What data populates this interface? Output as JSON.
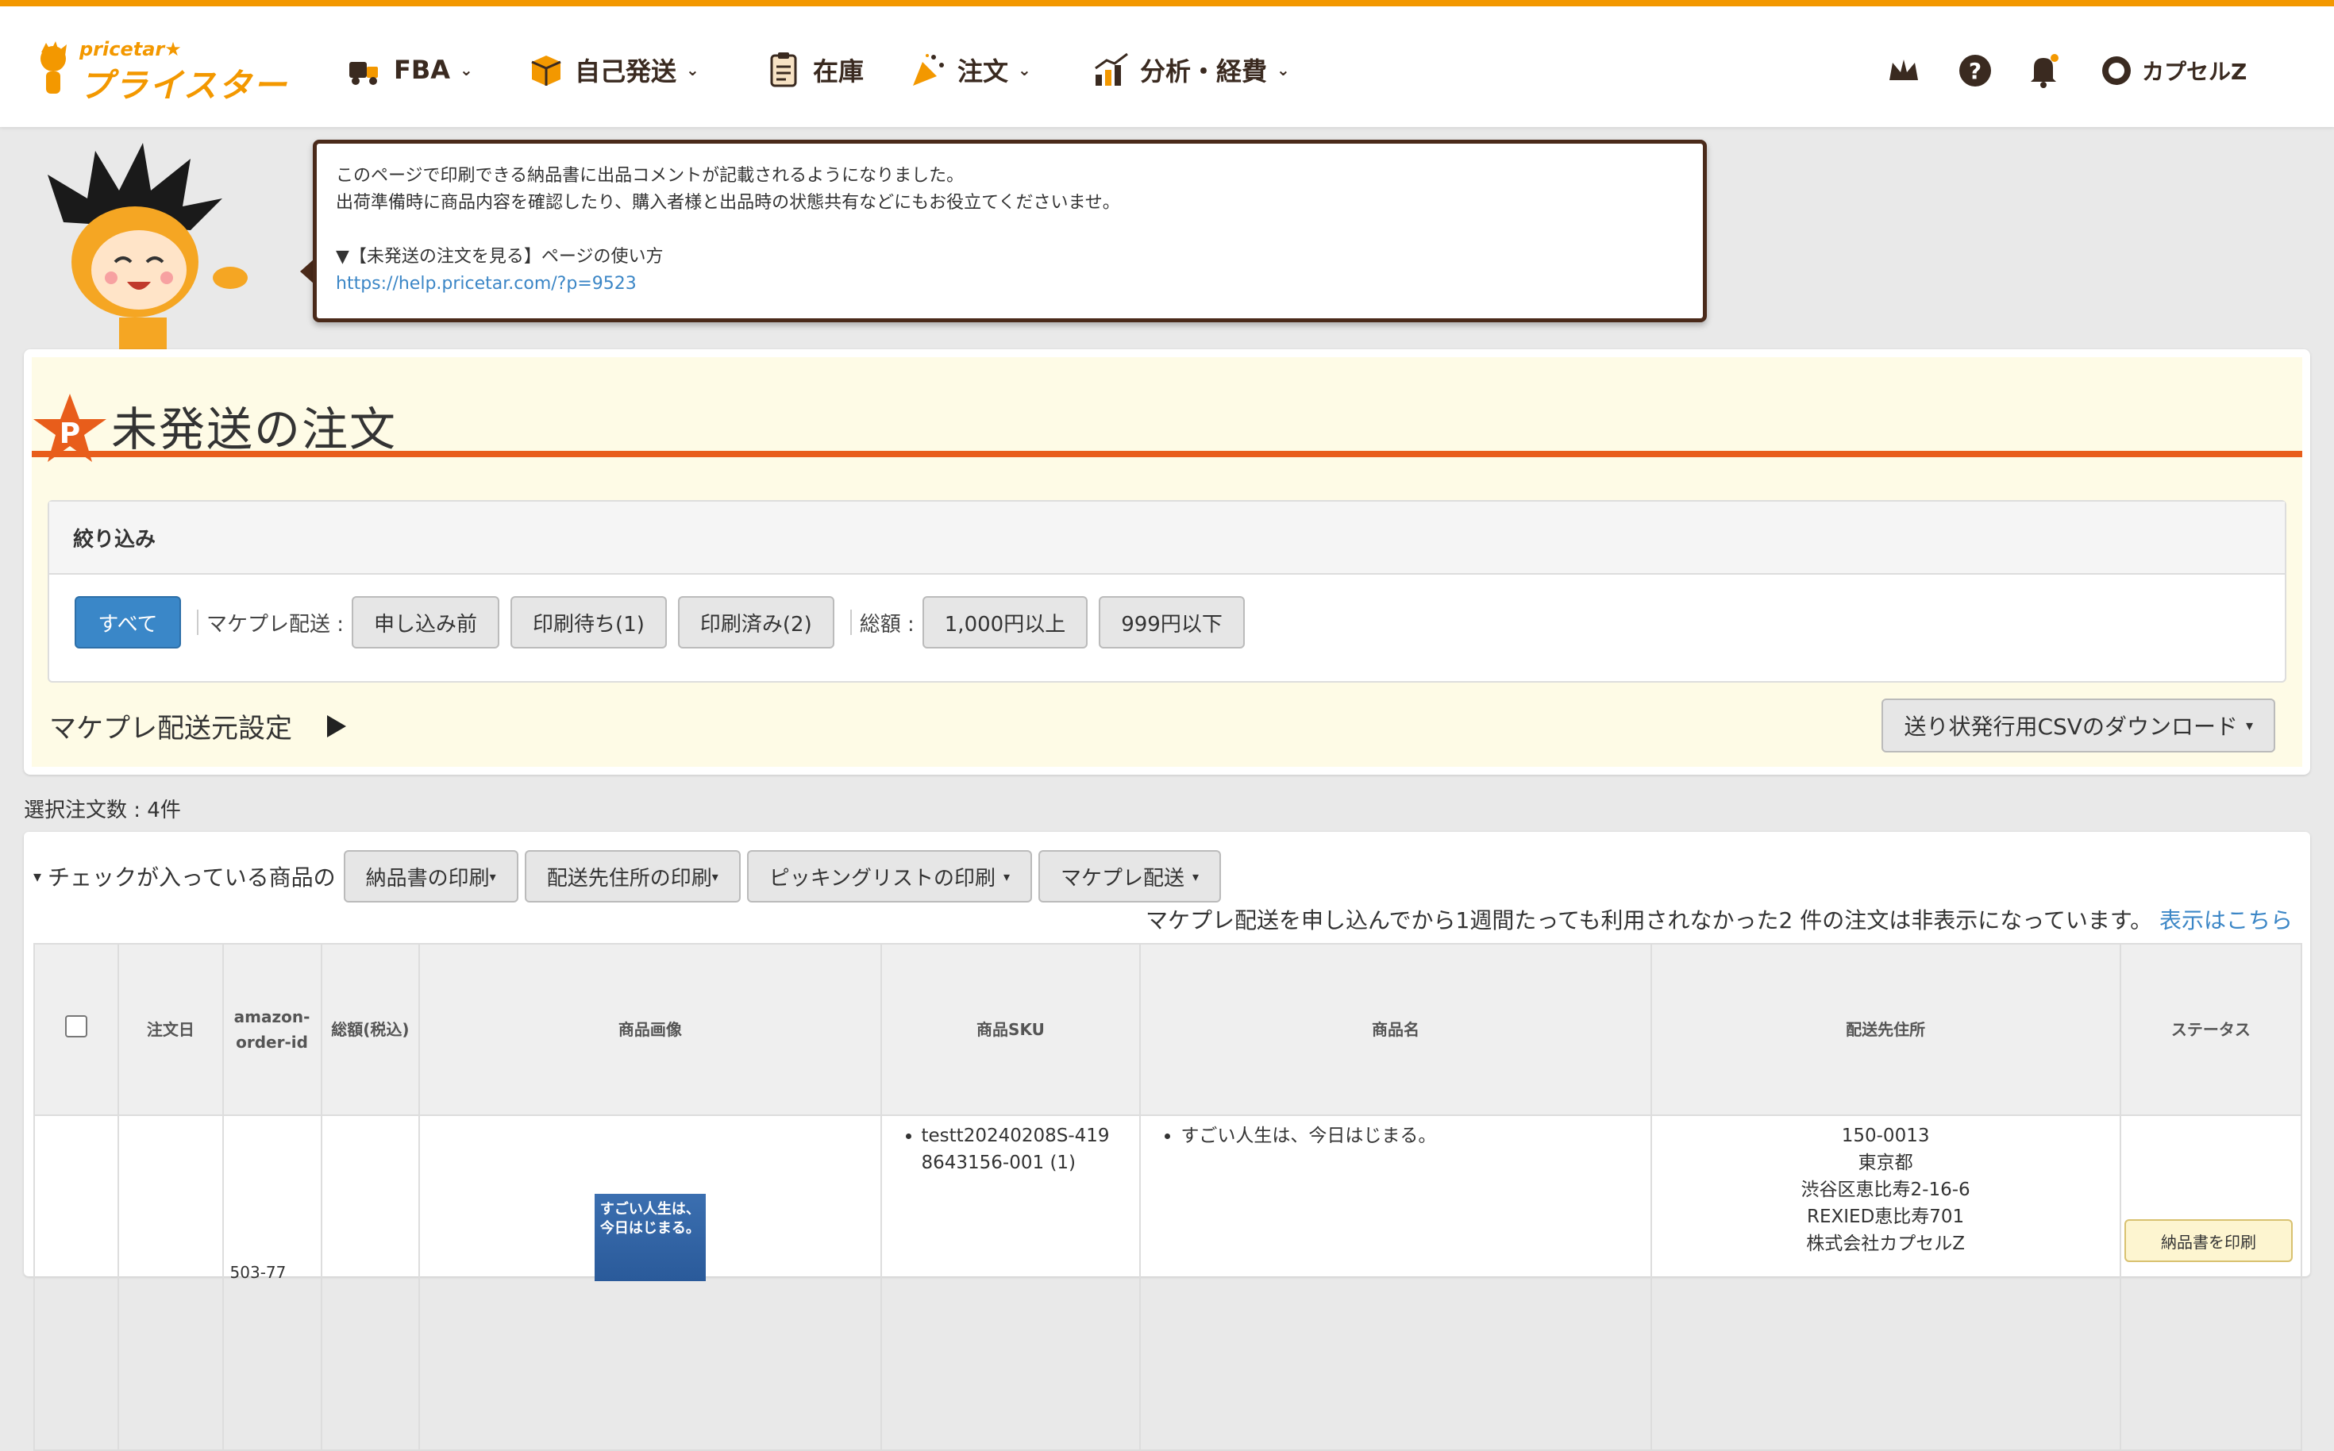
{
  "brand": {
    "logo_small": "pricetar★",
    "logo_big": "プライスター"
  },
  "nav": {
    "items": [
      {
        "label": "FBA",
        "icon": "truck-icon"
      },
      {
        "label": "自己発送",
        "icon": "box-icon"
      },
      {
        "label": "在庫",
        "icon": "clipboard-icon"
      },
      {
        "label": "注文",
        "icon": "party-icon"
      },
      {
        "label": "分析・経費",
        "icon": "chart-icon"
      }
    ],
    "user_name": "カプセルZ",
    "help_glyph": "?"
  },
  "notice": {
    "line1": "このページで印刷できる納品書に出品コメントが記載されるようになりました。",
    "line2": "出荷準備時に商品内容を確認したり、購入者様と出品時の状態共有などにもお役立てくださいませ。",
    "line3": "▼【未発送の注文を見る】ページの使い方",
    "link": "https://help.pricetar.com/?p=9523"
  },
  "page": {
    "star_letter": "P",
    "title": "未発送の注文"
  },
  "filter": {
    "heading": "絞り込み",
    "all_label": "すべて",
    "makepure_label": "マケプレ配送 :",
    "makepure_options": [
      "申し込み前",
      "印刷待ち(1)",
      "印刷済み(2)"
    ],
    "total_label": "総額 :",
    "total_options": [
      "1,000円以上",
      "999円以下"
    ]
  },
  "origin": {
    "label": "マケプレ配送元設定"
  },
  "csv_button": "送り状発行用CSVのダウンロード",
  "selected_count": "選択注文数 : 4件",
  "actions": {
    "label": "チェックが入っている商品の",
    "buttons": [
      "納品書の印刷",
      "配送先住所の印刷",
      "ピッキングリストの印刷",
      "マケプレ配送"
    ]
  },
  "hidden_note": {
    "text": "マケプレ配送を申し込んでから1週間たっても利用されなかった2 件の注文は非表示になっています。",
    "link": "表示はこちら"
  },
  "table": {
    "headers": {
      "date": "注文日",
      "order_id": "amazon-order-id",
      "total": "総額(税込)",
      "image": "商品画像",
      "sku": "商品SKU",
      "name": "商品名",
      "address": "配送先住所",
      "status": "ステータス"
    },
    "rows": [
      {
        "order_id_partial": "503-77",
        "book_text": "すごい人生は、今日はじまる。",
        "sku": "testt20240208S-4198643156-001 (1)",
        "name": "すごい人生は、今日はじまる。",
        "address": [
          "150-0013",
          "東京都",
          "渋谷区恵比寿2-16-6",
          "REXIED恵比寿701",
          "株式会社カプセルZ"
        ],
        "status_button": "納品書を印刷"
      }
    ]
  }
}
